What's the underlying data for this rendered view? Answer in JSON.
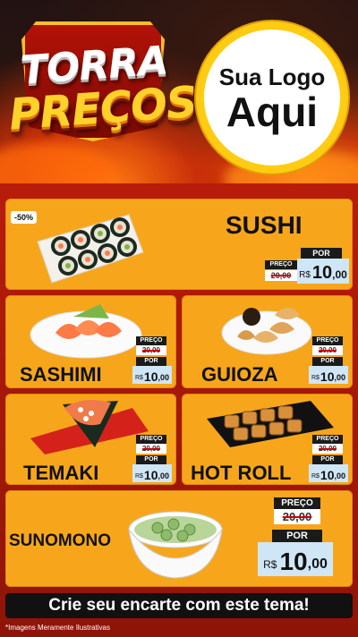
{
  "header": {
    "title_line1": "TORRA",
    "title_line2": "PREÇOS",
    "logo_line1": "Sua Logo",
    "logo_line2": "Aqui"
  },
  "labels": {
    "preco": "PREÇO",
    "por": "POR",
    "currency": "R$",
    "old_value": "20,00",
    "new_value_int": "10",
    "new_value_dec": ",00"
  },
  "items": [
    {
      "name": "SUSHI",
      "badge": "-50%"
    },
    {
      "name": "SASHIMI"
    },
    {
      "name": "GUIOZA"
    },
    {
      "name": "TEMAKI"
    },
    {
      "name": "HOT ROLL"
    },
    {
      "name": "SUNOMONO"
    }
  ],
  "footer": {
    "cta": "Crie seu encarte com este tema!",
    "disclaimer": "*Imagens Meramente Ilustrativas"
  },
  "colors": {
    "card": "#f7a61c",
    "background": "#b81c0a",
    "logo_ring": "#ffcc12",
    "price_box": "#cfe6f6"
  }
}
